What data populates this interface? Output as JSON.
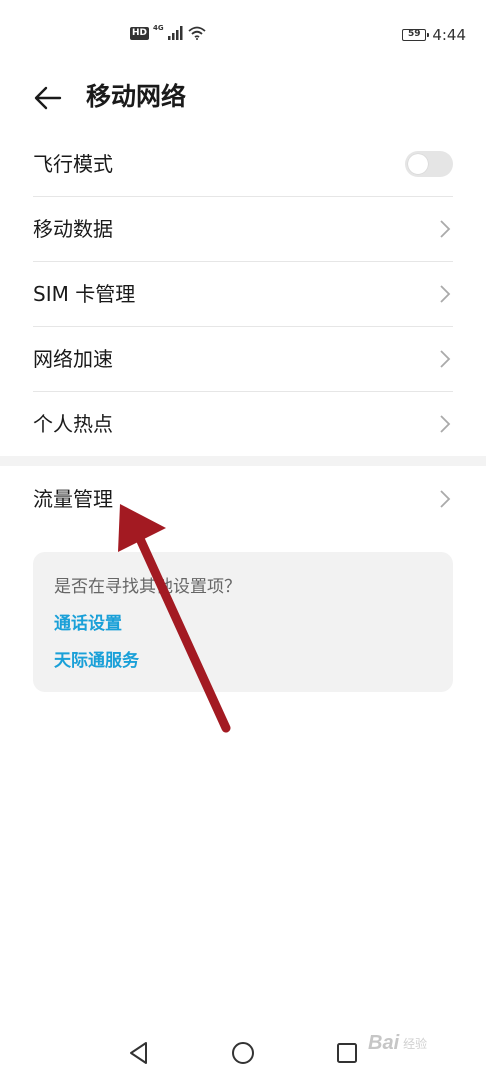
{
  "status_bar": {
    "hd_label": "HD",
    "network_label": "4G",
    "battery_level": "59",
    "time": "4:44"
  },
  "header": {
    "title": "移动网络"
  },
  "settings": {
    "airplane_mode": {
      "label": "飞行模式",
      "enabled": false
    },
    "items": [
      {
        "label": "移动数据"
      },
      {
        "label": "SIM 卡管理"
      },
      {
        "label": "网络加速"
      },
      {
        "label": "个人热点"
      }
    ],
    "traffic_management": {
      "label": "流量管理"
    }
  },
  "suggestions": {
    "question": "是否在寻找其他设置项？",
    "links": [
      {
        "label": "通话设置"
      },
      {
        "label": "天际通服务"
      }
    ]
  },
  "watermark": {
    "text": "Bai",
    "sub": "经验"
  },
  "colors": {
    "link": "#1aa0d8",
    "annotation_arrow": "#a31a22",
    "toggle_off": "#e5e5e5"
  }
}
